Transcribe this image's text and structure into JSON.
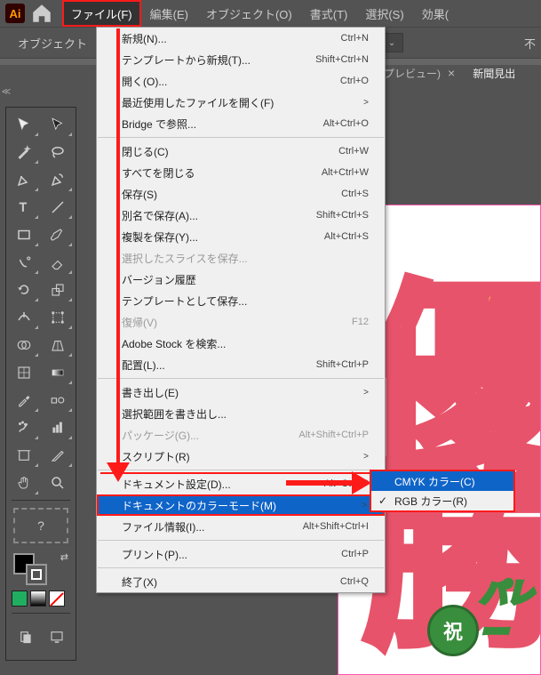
{
  "app": {
    "logo": "Ai"
  },
  "menubar": [
    "ファイル(F)",
    "編集(E)",
    "オブジェクト(O)",
    "書式(T)",
    "選択(S)",
    "効果("
  ],
  "menubar_active_index": 0,
  "controlbar": {
    "label": "オブジェクト",
    "extra": "不"
  },
  "tabs": {
    "preview": "プレビュー)",
    "close": "×",
    "doc2": "新聞見出"
  },
  "dropdown": [
    {
      "type": "item",
      "label": "新規(N)...",
      "shortcut": "Ctrl+N"
    },
    {
      "type": "item",
      "label": "テンプレートから新規(T)...",
      "shortcut": "Shift+Ctrl+N"
    },
    {
      "type": "item",
      "label": "開く(O)...",
      "shortcut": "Ctrl+O"
    },
    {
      "type": "item",
      "label": "最近使用したファイルを開く(F)",
      "submenu": true
    },
    {
      "type": "item",
      "label": "Bridge で参照...",
      "shortcut": "Alt+Ctrl+O"
    },
    {
      "type": "div"
    },
    {
      "type": "item",
      "label": "閉じる(C)",
      "shortcut": "Ctrl+W"
    },
    {
      "type": "item",
      "label": "すべてを閉じる",
      "shortcut": "Alt+Ctrl+W"
    },
    {
      "type": "item",
      "label": "保存(S)",
      "shortcut": "Ctrl+S"
    },
    {
      "type": "item",
      "label": "別名で保存(A)...",
      "shortcut": "Shift+Ctrl+S"
    },
    {
      "type": "item",
      "label": "複製を保存(Y)...",
      "shortcut": "Alt+Ctrl+S"
    },
    {
      "type": "item",
      "label": "選択したスライスを保存...",
      "disabled": true
    },
    {
      "type": "item",
      "label": "バージョン履歴"
    },
    {
      "type": "item",
      "label": "テンプレートとして保存..."
    },
    {
      "type": "item",
      "label": "復帰(V)",
      "shortcut": "F12",
      "disabled": true
    },
    {
      "type": "item",
      "label": "Adobe Stock を検索..."
    },
    {
      "type": "item",
      "label": "配置(L)...",
      "shortcut": "Shift+Ctrl+P"
    },
    {
      "type": "div"
    },
    {
      "type": "item",
      "label": "書き出し(E)",
      "submenu": true
    },
    {
      "type": "item",
      "label": "選択範囲を書き出し..."
    },
    {
      "type": "item",
      "label": "パッケージ(G)...",
      "shortcut": "Alt+Shift+Ctrl+P",
      "disabled": true
    },
    {
      "type": "item",
      "label": "スクリプト(R)",
      "submenu": true
    },
    {
      "type": "div"
    },
    {
      "type": "item",
      "label": "ドキュメント設定(D)...",
      "shortcut": "Alt+Ctrl+P"
    },
    {
      "type": "item",
      "label": "ドキュメントのカラーモード(M)",
      "submenu": true,
      "highlight": true
    },
    {
      "type": "item",
      "label": "ファイル情報(I)...",
      "shortcut": "Alt+Shift+Ctrl+I"
    },
    {
      "type": "div"
    },
    {
      "type": "item",
      "label": "プリント(P)...",
      "shortcut": "Ctrl+P"
    },
    {
      "type": "div"
    },
    {
      "type": "item",
      "label": "終了(X)",
      "shortcut": "Ctrl+Q"
    }
  ],
  "submenu": [
    {
      "label": "CMYK カラー(C)",
      "highlight": true
    },
    {
      "label": "RGB カラー(R)",
      "checked": true
    }
  ],
  "canvas": {
    "big1": "優",
    "big2": "勝",
    "badge": "祝",
    "badge_text": "パレー"
  },
  "question": "?"
}
